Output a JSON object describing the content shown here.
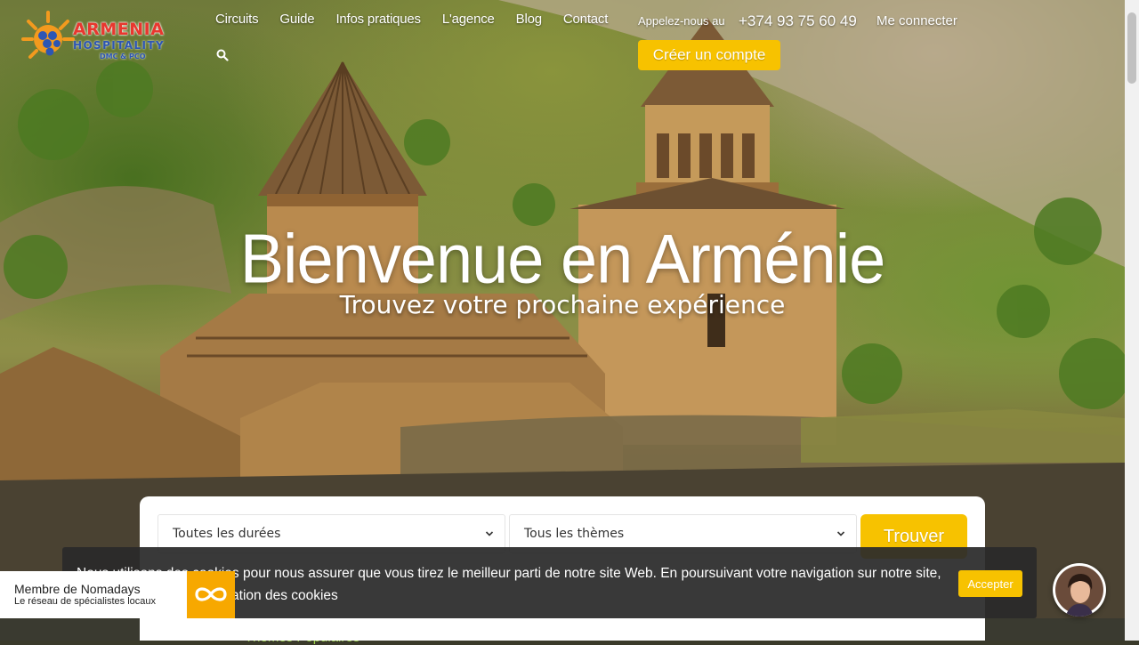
{
  "brand": {
    "name_line1": "ARMENIA",
    "name_line2": "HOSPITALITY",
    "name_line3": "DMC & PCO"
  },
  "nav": {
    "items": [
      {
        "label": "Circuits"
      },
      {
        "label": "Guide"
      },
      {
        "label": "Infos pratiques"
      },
      {
        "label": "L'agence"
      },
      {
        "label": "Blog"
      },
      {
        "label": "Contact"
      }
    ],
    "search_icon": "search-icon"
  },
  "header": {
    "call_label": "Appelez-nous au",
    "phone": "+374 93 75 60 49",
    "login_label": "Me connecter",
    "signup_label": "Créer un compte"
  },
  "hero": {
    "title": "Bienvenue en Arménie",
    "subtitle": "Trouvez votre prochaine expérience"
  },
  "search": {
    "duration_value": "Toutes les durées",
    "theme_value": "Tous les thèmes",
    "submit_label": "Trouver"
  },
  "cookie": {
    "message": "Nous utilisons des cookies pour nous assurer que vous tirez le meilleur parti de notre site Web. En poursuivant votre navigation sur notre site, vous acceptez notre utilisation des cookies",
    "accept_label": "Accepter"
  },
  "nomadays": {
    "title": "Membre de Nomadays",
    "subtitle": "Le réseau de spécialistes locaux"
  },
  "below_fold": {
    "partial_heading": "Thèmes Populaires"
  },
  "colors": {
    "accent": "#f7c200",
    "nomadays_orange": "#f7a800",
    "cookie_bg": "#2a2a2a"
  }
}
